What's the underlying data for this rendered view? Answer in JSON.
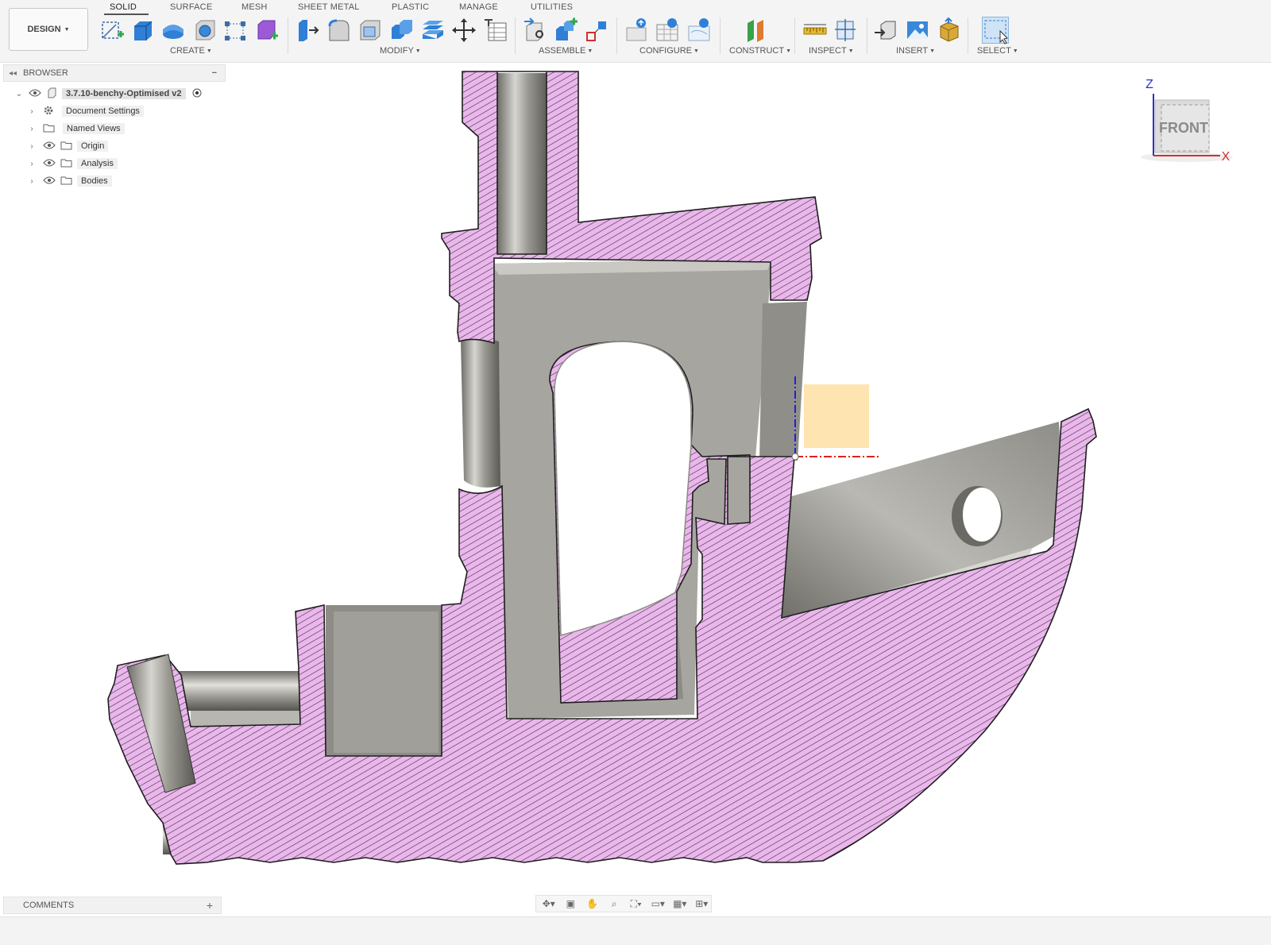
{
  "workspace": {
    "label": "DESIGN"
  },
  "tabs": [
    {
      "label": "SOLID",
      "active": true
    },
    {
      "label": "SURFACE"
    },
    {
      "label": "MESH"
    },
    {
      "label": "SHEET METAL"
    },
    {
      "label": "PLASTIC"
    },
    {
      "label": "MANAGE"
    },
    {
      "label": "UTILITIES"
    }
  ],
  "groups": {
    "create": "CREATE",
    "modify": "MODIFY",
    "assemble": "ASSEMBLE",
    "configure": "CONFIGURE",
    "construct": "CONSTRUCT",
    "inspect": "INSPECT",
    "insert": "INSERT",
    "select": "SELECT"
  },
  "browser": {
    "title": "BROWSER",
    "root": "3.7.10-benchy-Optimised v2",
    "items": [
      {
        "label": "Document Settings",
        "icon": "gear-icon"
      },
      {
        "label": "Named Views",
        "icon": "folder-icon"
      },
      {
        "label": "Origin",
        "icon": "folder-icon"
      },
      {
        "label": "Analysis",
        "icon": "folder-icon"
      },
      {
        "label": "Bodies",
        "icon": "folder-icon"
      }
    ]
  },
  "viewcube": {
    "face": "FRONT",
    "axis_z": "Z",
    "axis_x": "X"
  },
  "comments": {
    "title": "COMMENTS"
  },
  "colors": {
    "section_hatch_fill": "#eab6ec",
    "section_hatch_line": "#2a2a2a",
    "body_grey": "#a3a29c",
    "sketch_plane": "#fde4b0",
    "axis_red": "#e02020",
    "axis_blue": "#2020d0"
  }
}
